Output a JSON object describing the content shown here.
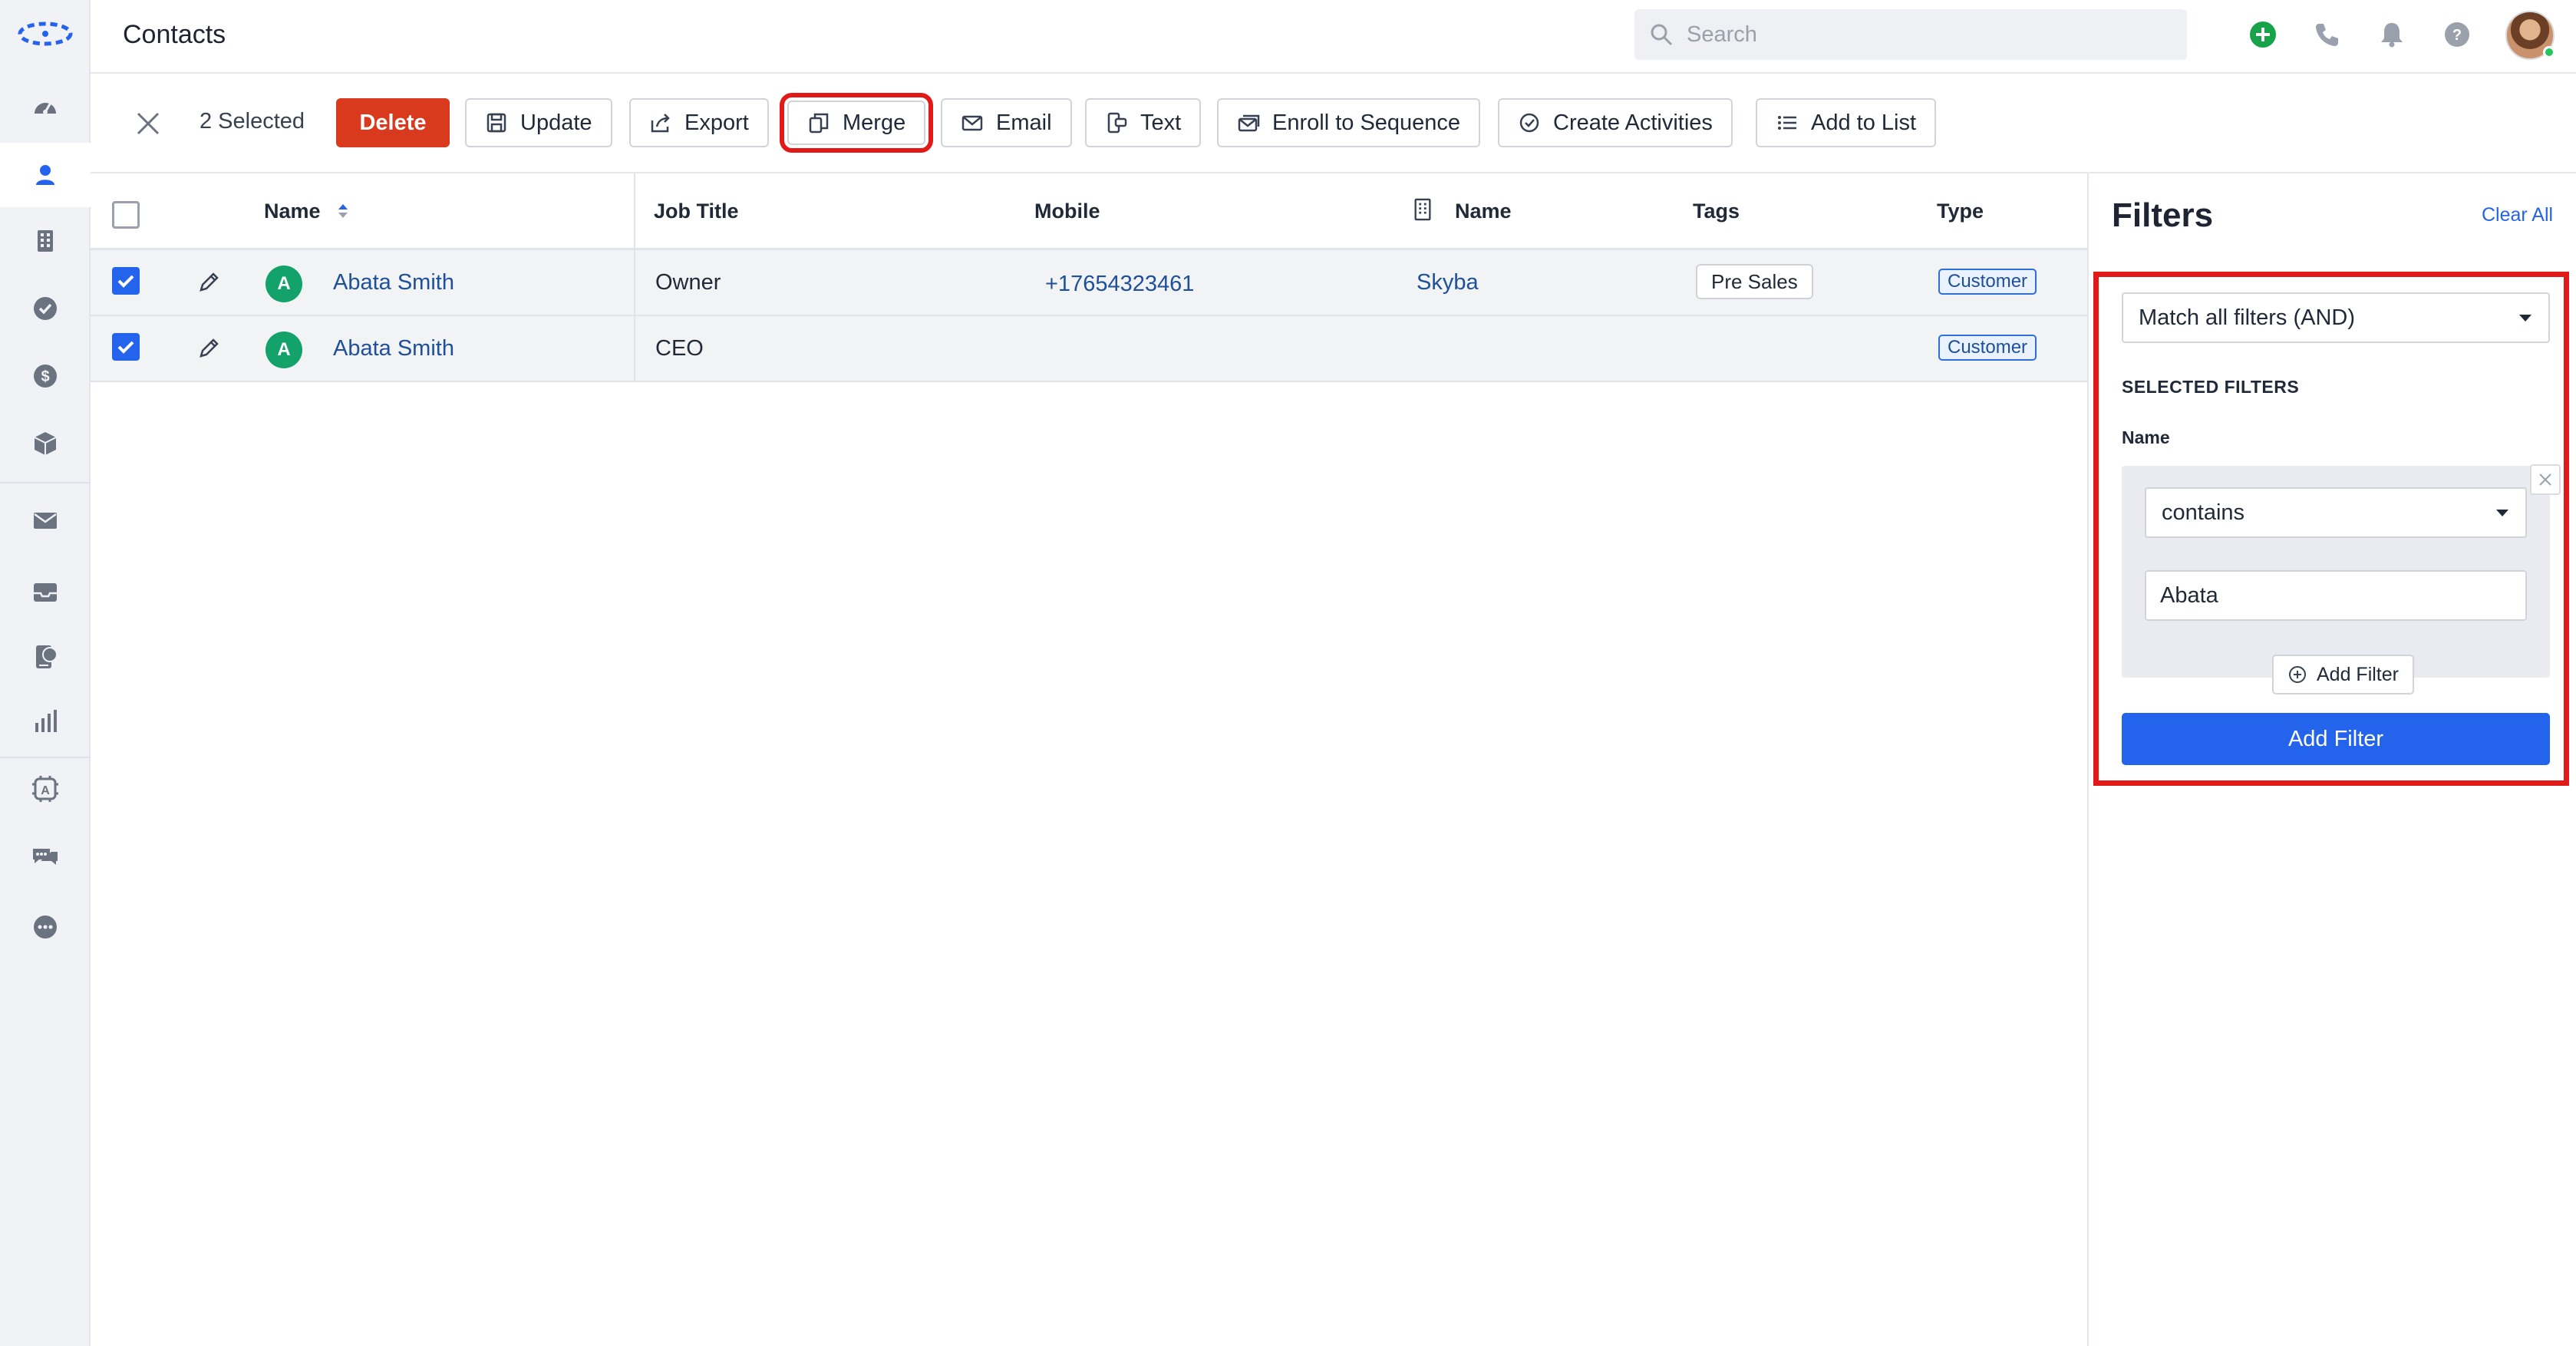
{
  "app": {
    "page_title": "Contacts"
  },
  "search": {
    "placeholder": "Search"
  },
  "colors": {
    "accent": "#2463eb",
    "danger": "#d93a1e",
    "success": "#12a26a",
    "highlight": "#e11919"
  },
  "sidebar": {
    "items": [
      {
        "icon": "dashboard-icon"
      },
      {
        "icon": "contacts-icon",
        "active": true
      },
      {
        "icon": "companies-icon"
      },
      {
        "icon": "tasks-icon"
      },
      {
        "icon": "deals-icon"
      },
      {
        "icon": "products-icon"
      },
      {
        "icon": "email-icon"
      },
      {
        "icon": "inbox-icon"
      },
      {
        "icon": "phone-chat-icon"
      },
      {
        "icon": "reports-icon"
      },
      {
        "icon": "automation-icon"
      },
      {
        "icon": "chat-icon"
      },
      {
        "icon": "more-icon"
      }
    ]
  },
  "topbar": {
    "icons": [
      "add-icon",
      "phone-icon",
      "bell-icon",
      "help-icon"
    ]
  },
  "actionbar": {
    "selected_count": "2 Selected",
    "delete": "Delete",
    "update": "Update",
    "export": "Export",
    "merge": "Merge",
    "email": "Email",
    "text": "Text",
    "enroll": "Enroll to Sequence",
    "create_activities": "Create Activities",
    "add_to_list": "Add to List"
  },
  "table": {
    "columns": {
      "name": "Name",
      "job_title": "Job Title",
      "mobile": "Mobile",
      "company_name": "Name",
      "tags": "Tags",
      "type": "Type"
    },
    "rows": [
      {
        "checked": true,
        "initial": "A",
        "name": "Abata Smith",
        "job_title": "Owner",
        "mobile": "+17654323461",
        "company": "Skyba",
        "tag": "Pre Sales",
        "type": "Customer"
      },
      {
        "checked": true,
        "initial": "A",
        "name": "Abata Smith",
        "job_title": "CEO",
        "mobile": "",
        "company": "",
        "tag": "",
        "type": "Customer"
      }
    ]
  },
  "filters": {
    "title": "Filters",
    "clear_all": "Clear All",
    "match_mode": "Match all filters (AND)",
    "selected_label": "SELECTED FILTERS",
    "field_label": "Name",
    "operator": "contains",
    "value": "Abata",
    "add_filter_small": "Add Filter",
    "add_filter_primary": "Add Filter"
  }
}
